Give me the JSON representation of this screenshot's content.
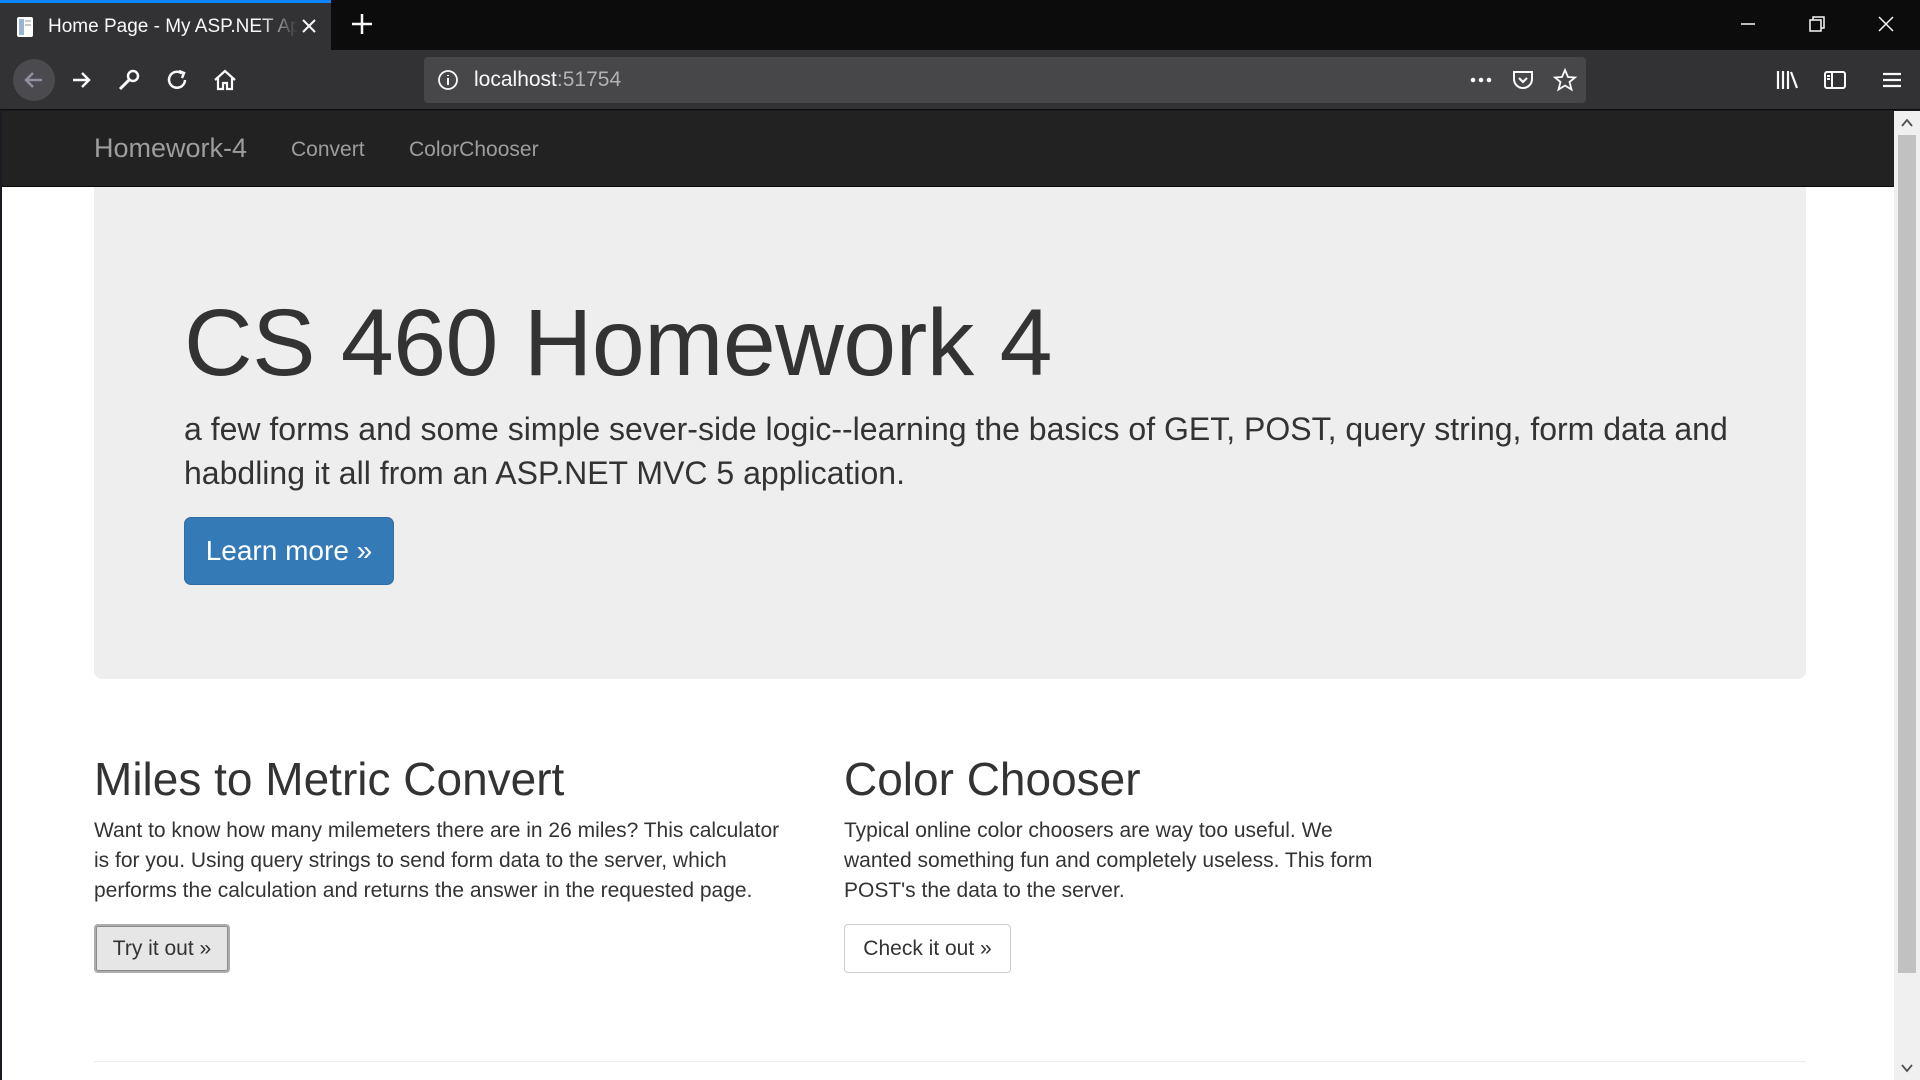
{
  "browser": {
    "tab": {
      "title": "Home Page - My ASP.NET Application"
    },
    "url": {
      "host": "localhost",
      "port": ":51754"
    }
  },
  "site": {
    "brand": "Homework-4",
    "nav": [
      "Convert",
      "ColorChooser"
    ]
  },
  "jumbotron": {
    "title": "CS 460 Homework 4",
    "lead": "a few forms and some simple sever-side logic--learning the basics of GET, POST, query string, form data and habdling it all from an ASP.NET MVC 5 application.",
    "button": "Learn more »"
  },
  "columns": [
    {
      "title": "Miles to Metric Convert",
      "text": "Want to know how many milemeters there are in 26 miles? This calculator is for you. Using query strings to send form data to the server, which performs the calculation and returns the answer in the requested page.",
      "button": "Try it out »"
    },
    {
      "title": "Color Chooser",
      "text": "Typical online color choosers are way too useful. We wanted something fun and completely useless. This form POST's the data to the server.",
      "button": "Check it out »"
    }
  ],
  "colors": {
    "accent": "#0a84ff",
    "primary_button": "#337ab7",
    "site_nav": "#222222",
    "jumbotron": "#eeeeee"
  }
}
